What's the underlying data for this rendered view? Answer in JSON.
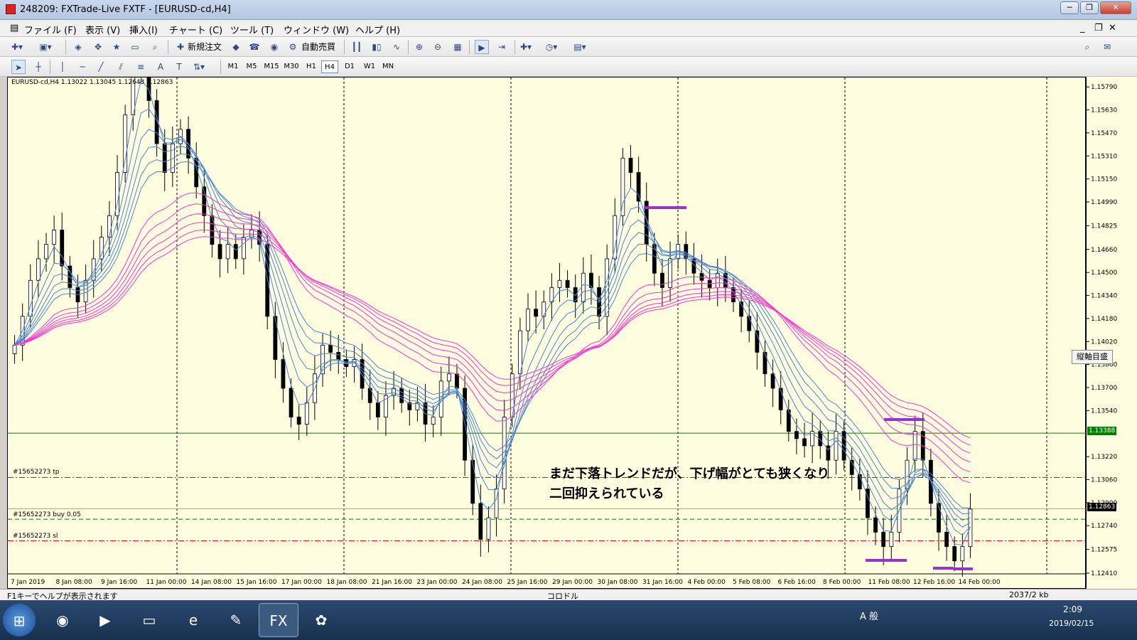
{
  "window": {
    "title": "248209: FXTrade-Live FXTF - [EURUSD-cd,H4]"
  },
  "menu": [
    "ファイル (F)",
    "表示 (V)",
    "挿入(I)",
    "チャート (C)",
    "ツール (T)",
    "ウィンドウ (W)",
    "ヘルプ (H)"
  ],
  "toolbar": {
    "new_order": "新規注文",
    "auto_trade": "自動売買"
  },
  "timeframes": [
    {
      "label": "M1",
      "selected": false
    },
    {
      "label": "M5",
      "selected": false
    },
    {
      "label": "M15",
      "selected": false
    },
    {
      "label": "M30",
      "selected": false
    },
    {
      "label": "H1",
      "selected": false
    },
    {
      "label": "H4",
      "selected": true
    },
    {
      "label": "D1",
      "selected": false
    },
    {
      "label": "W1",
      "selected": false
    },
    {
      "label": "MN",
      "selected": false
    }
  ],
  "chart": {
    "header": "EURUSD-cd,H4  1.13022 1.13045 1.12643 1.12863",
    "annotation_line1": "まだ下落トレンドだが、下げ幅がとても狭くなり",
    "annotation_line2": "二回抑えられている",
    "order_labels": {
      "tp": "#15652273 tp",
      "buy": "#15652273 buy 0.05",
      "sl": "#15652273 sl"
    },
    "right_tag": "縦軸目盛",
    "current_price": "1.12863",
    "green_line_price": "1.13388"
  },
  "chart_data": {
    "type": "candlestick",
    "symbol": "EURUSD-cd",
    "timeframe": "H4",
    "ohlc_readout": {
      "open": 1.13022,
      "high": 1.13045,
      "low": 1.12643,
      "close": 1.12863
    },
    "y_ticks": [
      "1.15790",
      "1.15630",
      "1.15470",
      "1.15310",
      "1.15150",
      "1.14990",
      "1.14825",
      "1.14660",
      "1.14500",
      "1.14340",
      "1.14180",
      "1.14020",
      "1.13860",
      "1.13700",
      "1.13540",
      "1.13388",
      "1.13220",
      "1.13060",
      "1.12900",
      "1.12863",
      "1.12740",
      "1.12575",
      "1.12410"
    ],
    "ylim": [
      1.1241,
      1.1586
    ],
    "x_ticks": [
      "7 Jan 2019",
      "8 Jan 08:00",
      "9 Jan 16:00",
      "11 Jan 00:00",
      "14 Jan 08:00",
      "15 Jan 16:00",
      "17 Jan 00:00",
      "18 Jan 08:00",
      "21 Jan 16:00",
      "23 Jan 00:00",
      "24 Jan 08:00",
      "25 Jan 16:00",
      "29 Jan 00:00",
      "30 Jan 08:00",
      "31 Jan 16:00",
      "4 Feb 00:00",
      "5 Feb 08:00",
      "6 Feb 16:00",
      "8 Feb 00:00",
      "11 Feb 08:00",
      "12 Feb 16:00",
      "14 Feb 00:00"
    ],
    "close_series": [
      1.14,
      1.142,
      1.1445,
      1.146,
      1.147,
      1.148,
      1.1455,
      1.144,
      1.143,
      1.1445,
      1.146,
      1.1475,
      1.149,
      1.152,
      1.156,
      1.159,
      1.161,
      1.157,
      1.154,
      1.152,
      1.154,
      1.155,
      1.153,
      1.151,
      1.149,
      1.147,
      1.146,
      1.147,
      1.146,
      1.1475,
      1.148,
      1.147,
      1.142,
      1.139,
      1.137,
      1.135,
      1.1345,
      1.136,
      1.138,
      1.14,
      1.1395,
      1.139,
      1.1385,
      1.139,
      1.137,
      1.136,
      1.135,
      1.1365,
      1.137,
      1.136,
      1.1355,
      1.136,
      1.1345,
      1.135,
      1.1375,
      1.138,
      1.137,
      1.132,
      1.129,
      1.1265,
      1.128,
      1.13,
      1.135,
      1.138,
      1.141,
      1.1425,
      1.142,
      1.143,
      1.144,
      1.1445,
      1.144,
      1.143,
      1.145,
      1.144,
      1.142,
      1.146,
      1.149,
      1.153,
      1.152,
      1.15,
      1.147,
      1.145,
      1.144,
      1.146,
      1.147,
      1.146,
      1.145,
      1.1445,
      1.144,
      1.145,
      1.144,
      1.143,
      1.142,
      1.141,
      1.1395,
      1.138,
      1.137,
      1.1355,
      1.134,
      1.1335,
      1.133,
      1.134,
      1.133,
      1.132,
      1.134,
      1.132,
      1.131,
      1.13,
      1.128,
      1.127,
      1.126,
      1.127,
      1.13,
      1.132,
      1.134,
      1.132,
      1.129,
      1.127,
      1.126,
      1.125,
      1.126,
      1.1286
    ],
    "horizontal_lines": [
      {
        "name": "current-level",
        "price": 1.13388,
        "color": "#008000"
      },
      {
        "name": "tp",
        "price": 1.1308,
        "color": "#ff0000"
      },
      {
        "name": "buy",
        "price": 1.1279,
        "color": "#008000"
      },
      {
        "name": "sl",
        "price": 1.1264,
        "color": "#ff0000"
      }
    ],
    "colors": {
      "bull": "#ffffff",
      "bear": "#000000",
      "ma_fast": "#4a86d4",
      "ma_slow": "#ff33cc",
      "background": "#fffde0"
    }
  },
  "statusbar": {
    "help": "F1キーでヘルプが表示されます",
    "profile": "コロドル",
    "traffic": "2037/2 kb"
  },
  "taskbar": {
    "time": "2:09",
    "date": "2019/02/15",
    "ime": "A 般"
  }
}
